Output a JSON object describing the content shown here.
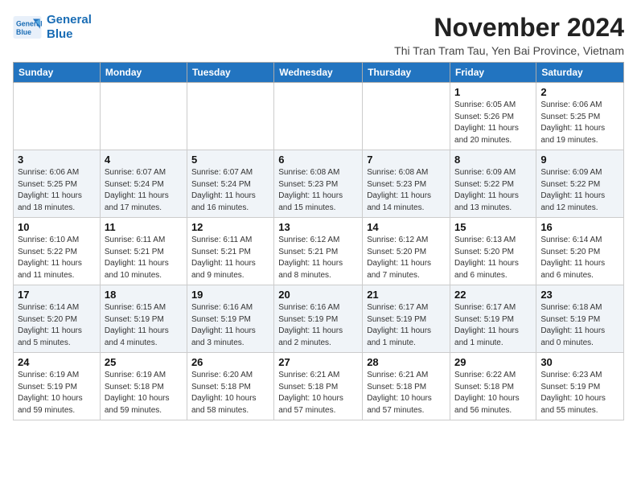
{
  "logo": {
    "line1": "General",
    "line2": "Blue"
  },
  "title": "November 2024",
  "subtitle": "Thi Tran Tram Tau, Yen Bai Province, Vietnam",
  "headers": [
    "Sunday",
    "Monday",
    "Tuesday",
    "Wednesday",
    "Thursday",
    "Friday",
    "Saturday"
  ],
  "weeks": [
    [
      {
        "day": "",
        "info": ""
      },
      {
        "day": "",
        "info": ""
      },
      {
        "day": "",
        "info": ""
      },
      {
        "day": "",
        "info": ""
      },
      {
        "day": "",
        "info": ""
      },
      {
        "day": "1",
        "info": "Sunrise: 6:05 AM\nSunset: 5:26 PM\nDaylight: 11 hours and 20 minutes."
      },
      {
        "day": "2",
        "info": "Sunrise: 6:06 AM\nSunset: 5:25 PM\nDaylight: 11 hours and 19 minutes."
      }
    ],
    [
      {
        "day": "3",
        "info": "Sunrise: 6:06 AM\nSunset: 5:25 PM\nDaylight: 11 hours and 18 minutes."
      },
      {
        "day": "4",
        "info": "Sunrise: 6:07 AM\nSunset: 5:24 PM\nDaylight: 11 hours and 17 minutes."
      },
      {
        "day": "5",
        "info": "Sunrise: 6:07 AM\nSunset: 5:24 PM\nDaylight: 11 hours and 16 minutes."
      },
      {
        "day": "6",
        "info": "Sunrise: 6:08 AM\nSunset: 5:23 PM\nDaylight: 11 hours and 15 minutes."
      },
      {
        "day": "7",
        "info": "Sunrise: 6:08 AM\nSunset: 5:23 PM\nDaylight: 11 hours and 14 minutes."
      },
      {
        "day": "8",
        "info": "Sunrise: 6:09 AM\nSunset: 5:22 PM\nDaylight: 11 hours and 13 minutes."
      },
      {
        "day": "9",
        "info": "Sunrise: 6:09 AM\nSunset: 5:22 PM\nDaylight: 11 hours and 12 minutes."
      }
    ],
    [
      {
        "day": "10",
        "info": "Sunrise: 6:10 AM\nSunset: 5:22 PM\nDaylight: 11 hours and 11 minutes."
      },
      {
        "day": "11",
        "info": "Sunrise: 6:11 AM\nSunset: 5:21 PM\nDaylight: 11 hours and 10 minutes."
      },
      {
        "day": "12",
        "info": "Sunrise: 6:11 AM\nSunset: 5:21 PM\nDaylight: 11 hours and 9 minutes."
      },
      {
        "day": "13",
        "info": "Sunrise: 6:12 AM\nSunset: 5:21 PM\nDaylight: 11 hours and 8 minutes."
      },
      {
        "day": "14",
        "info": "Sunrise: 6:12 AM\nSunset: 5:20 PM\nDaylight: 11 hours and 7 minutes."
      },
      {
        "day": "15",
        "info": "Sunrise: 6:13 AM\nSunset: 5:20 PM\nDaylight: 11 hours and 6 minutes."
      },
      {
        "day": "16",
        "info": "Sunrise: 6:14 AM\nSunset: 5:20 PM\nDaylight: 11 hours and 6 minutes."
      }
    ],
    [
      {
        "day": "17",
        "info": "Sunrise: 6:14 AM\nSunset: 5:20 PM\nDaylight: 11 hours and 5 minutes."
      },
      {
        "day": "18",
        "info": "Sunrise: 6:15 AM\nSunset: 5:19 PM\nDaylight: 11 hours and 4 minutes."
      },
      {
        "day": "19",
        "info": "Sunrise: 6:16 AM\nSunset: 5:19 PM\nDaylight: 11 hours and 3 minutes."
      },
      {
        "day": "20",
        "info": "Sunrise: 6:16 AM\nSunset: 5:19 PM\nDaylight: 11 hours and 2 minutes."
      },
      {
        "day": "21",
        "info": "Sunrise: 6:17 AM\nSunset: 5:19 PM\nDaylight: 11 hours and 1 minute."
      },
      {
        "day": "22",
        "info": "Sunrise: 6:17 AM\nSunset: 5:19 PM\nDaylight: 11 hours and 1 minute."
      },
      {
        "day": "23",
        "info": "Sunrise: 6:18 AM\nSunset: 5:19 PM\nDaylight: 11 hours and 0 minutes."
      }
    ],
    [
      {
        "day": "24",
        "info": "Sunrise: 6:19 AM\nSunset: 5:19 PM\nDaylight: 10 hours and 59 minutes."
      },
      {
        "day": "25",
        "info": "Sunrise: 6:19 AM\nSunset: 5:18 PM\nDaylight: 10 hours and 59 minutes."
      },
      {
        "day": "26",
        "info": "Sunrise: 6:20 AM\nSunset: 5:18 PM\nDaylight: 10 hours and 58 minutes."
      },
      {
        "day": "27",
        "info": "Sunrise: 6:21 AM\nSunset: 5:18 PM\nDaylight: 10 hours and 57 minutes."
      },
      {
        "day": "28",
        "info": "Sunrise: 6:21 AM\nSunset: 5:18 PM\nDaylight: 10 hours and 57 minutes."
      },
      {
        "day": "29",
        "info": "Sunrise: 6:22 AM\nSunset: 5:18 PM\nDaylight: 10 hours and 56 minutes."
      },
      {
        "day": "30",
        "info": "Sunrise: 6:23 AM\nSunset: 5:19 PM\nDaylight: 10 hours and 55 minutes."
      }
    ]
  ]
}
